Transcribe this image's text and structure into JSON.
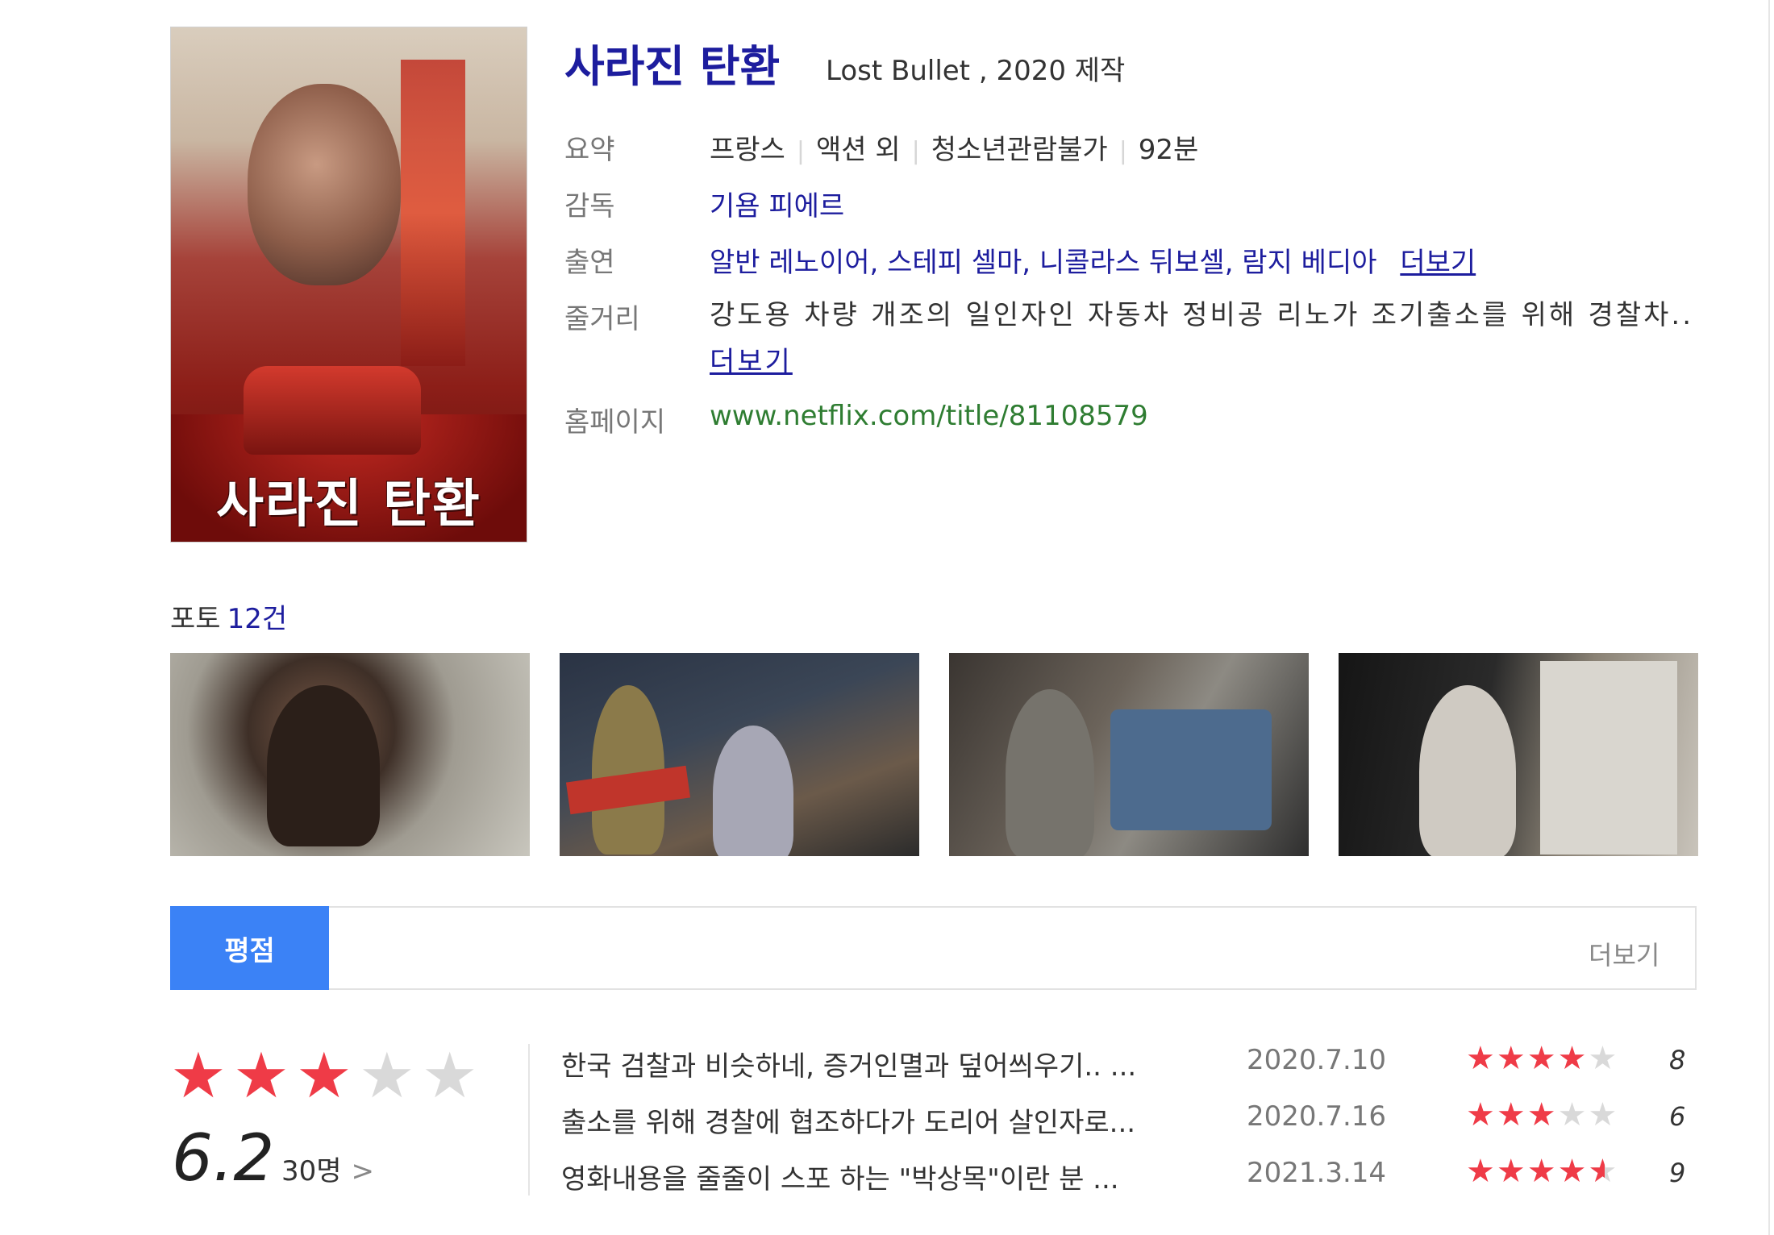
{
  "movie": {
    "title": "사라진 탄환",
    "subtitle": "Lost Bullet , 2020 제작",
    "poster_title": "사라진 탄환"
  },
  "info": {
    "summary_label": "요약",
    "summary": {
      "country": "프랑스",
      "genre": "액션 외",
      "rating": "청소년관람불가",
      "runtime": "92분"
    },
    "director_label": "감독",
    "director": "기욤 피에르",
    "cast_label": "출연",
    "cast": "알반 레노이어, 스테피 셀마, 니콜라스 뒤보셀, 람지 베디아",
    "cast_more": "더보기",
    "plot_label": "줄거리",
    "plot": "강도용 차량 개조의 일인자인 자동차 정비공 리노가 조기출소를 위해 경찰차..",
    "plot_more": "더보기",
    "homepage_label": "홈페이지",
    "homepage": "www.netflix.com/title/81108579"
  },
  "photos": {
    "label": "포토",
    "count": "12건",
    "items": [
      "photo-1",
      "photo-2",
      "photo-3",
      "photo-4"
    ]
  },
  "ratings": {
    "tab_label": "평점",
    "more_label": "더보기",
    "average": "6.2",
    "average_stars": 3,
    "voters": "30명",
    "voters_arrow": ">",
    "reviews": [
      {
        "text": "한국 검찰과 비슷하네, 증거인멸과 덮어씌우기.. ...",
        "date": "2020.7.10",
        "score": "8"
      },
      {
        "text": "출소를 위해 경찰에 협조하다가 도리어 살인자로...",
        "date": "2020.7.16",
        "score": "6"
      },
      {
        "text": "영화내용을 줄줄이 스포 하는 \"박상목\"이란 분 ...",
        "date": "2021.3.14",
        "score": "9"
      }
    ]
  },
  "colors": {
    "title_blue": "#1d1d9e",
    "link_green": "#2f7d32",
    "tab_blue": "#3b82f6",
    "star_red": "#ef3b47",
    "star_gray": "#d9d9d9"
  },
  "icons": {
    "star": "star-icon",
    "chevron": "chevron-right-icon"
  }
}
